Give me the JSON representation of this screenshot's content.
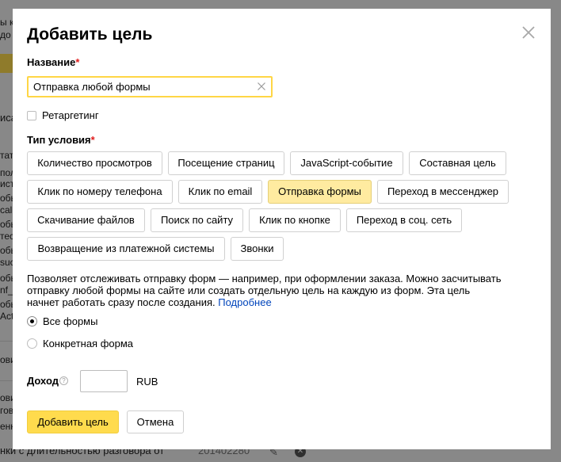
{
  "dialog": {
    "title": "Добавить цель",
    "name_label": "Название",
    "name_required": "*",
    "name_value": "Отправка любой формы",
    "retargeting_label": "Ретаргетинг",
    "condition_label": "Тип условия",
    "condition_required": "*",
    "condition_types": [
      "Количество просмотров",
      "Посещение страниц",
      "JavaScript-событие",
      "Составная цель",
      "Клик по номеру телефона",
      "Клик по email",
      "Отправка формы",
      "Переход в мессенджер",
      "Скачивание файлов",
      "Поиск по сайту",
      "Клик по кнопке",
      "Переход в соц. сеть",
      "Возвращение из платежной системы",
      "Звонки"
    ],
    "active_condition": "Отправка формы",
    "description": "Позволяет отслеживать отправку форм — например, при оформлении заказа. Можно засчитывать отправку любой формы на сайте или создать отдельную цель на каждую из форм. Эта цель начнет работать сразу после создания.",
    "more_link": "Подробнее",
    "form_options": [
      "Все формы",
      "Конкретная форма"
    ],
    "selected_form_option": "Все формы",
    "income_label": "Доход",
    "income_help": "?",
    "income_value": "",
    "currency": "RUB",
    "submit_label": "Добавить цель",
    "cancel_label": "Отмена"
  },
  "background": {
    "fragments": [
      "ы кн",
      "до",
      "иса",
      "тат",
      "пол",
      "ист",
      "обь",
      "call",
      "обь",
      "тес",
      "обь",
      "suc",
      "обь",
      "nf_",
      "обь",
      "Act",
      "ови",
      "ови",
      "гов",
      "енных"
    ],
    "bottom_text": "нки с длительностью разговора от",
    "bottom_number": "201402280"
  }
}
